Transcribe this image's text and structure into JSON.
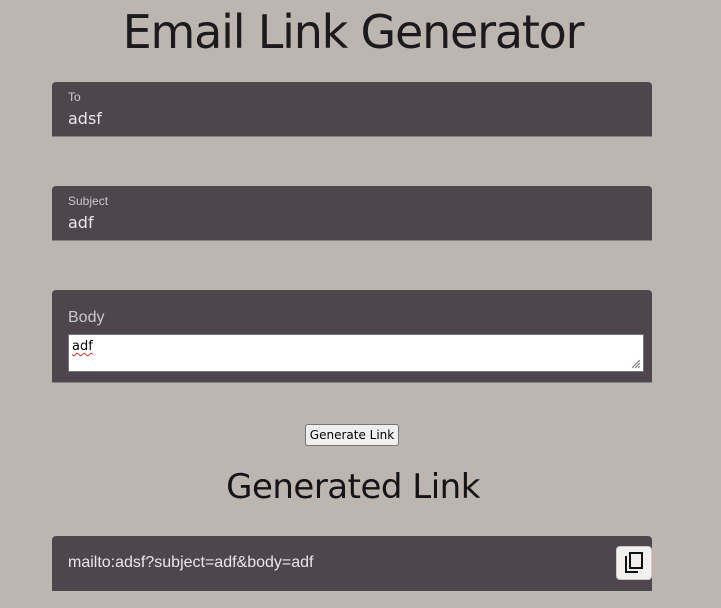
{
  "page": {
    "title": "Email Link Generator"
  },
  "form": {
    "to": {
      "label": "To",
      "value": "adsf"
    },
    "subject": {
      "label": "Subject",
      "value": "adf"
    },
    "body": {
      "label": "Body",
      "value": "adf"
    },
    "generate_label": "Generate Link"
  },
  "result": {
    "title": "Generated Link",
    "link": "mailto:adsf?subject=adf&body=adf",
    "copy_icon": "copy-icon"
  },
  "colors": {
    "background": "#bdb5b0",
    "field_background": "#4f464d",
    "field_text": "#ece6ea"
  }
}
